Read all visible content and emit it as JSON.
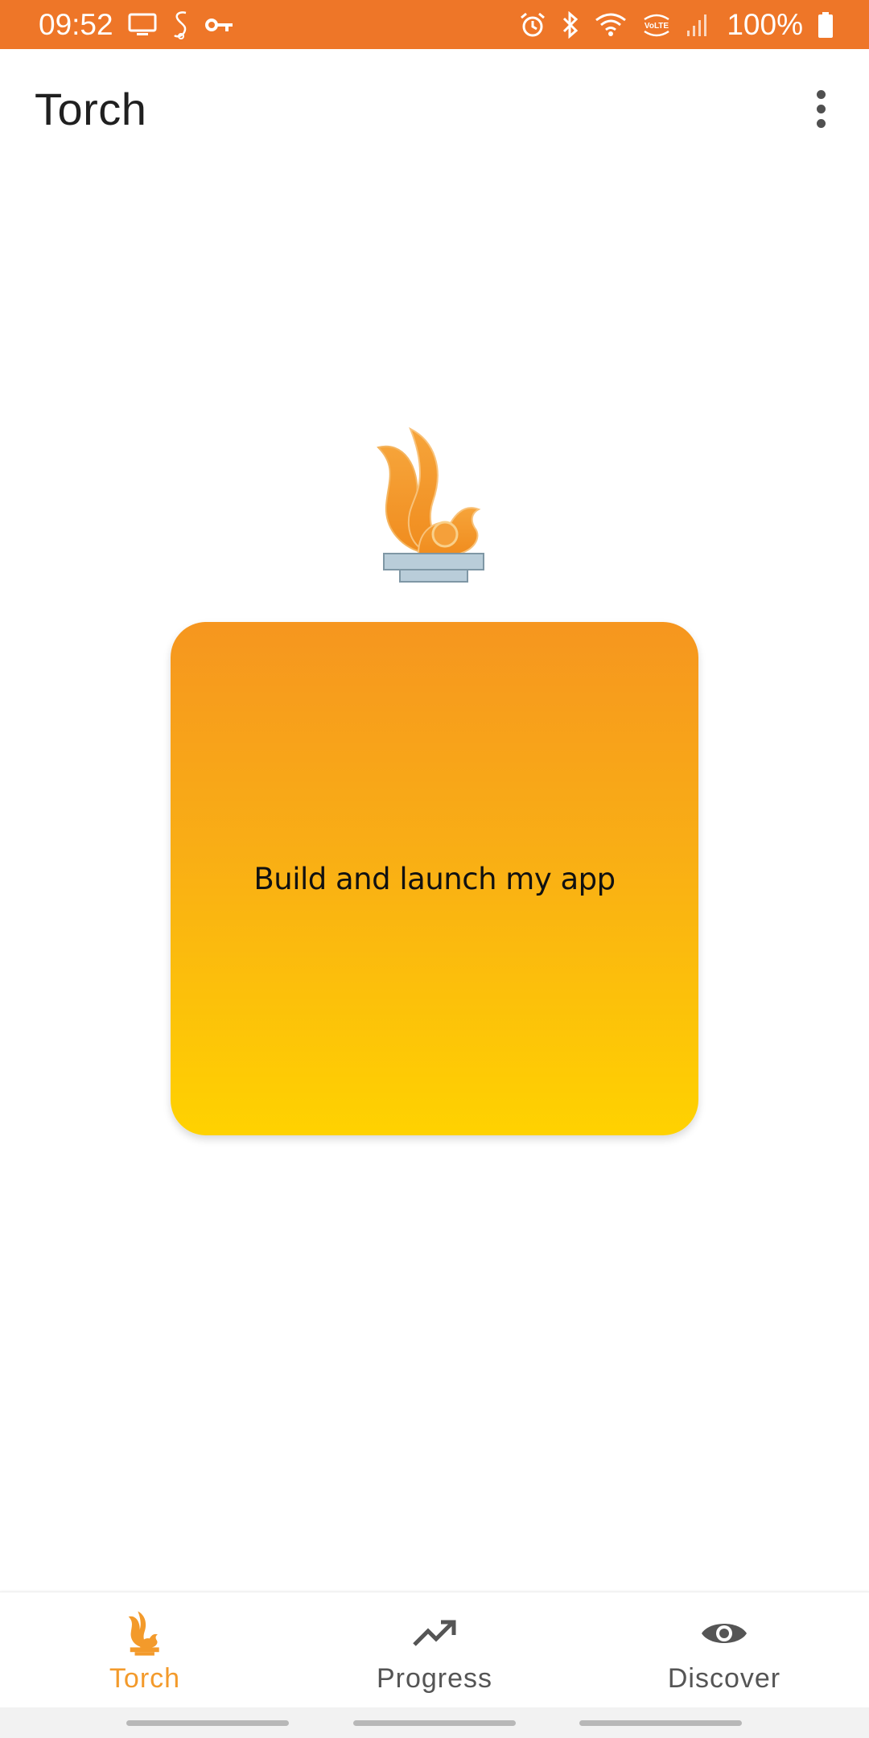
{
  "status_bar": {
    "time": "09:52",
    "battery": "100%",
    "left_icons": [
      "screen-cast-icon",
      "app-s-icon",
      "key-icon"
    ],
    "right_icons": [
      "alarm-icon",
      "bluetooth-icon",
      "wifi-icon",
      "volte-icon",
      "signal-icon",
      "battery-icon"
    ],
    "background_color": "#EE7628"
  },
  "app_bar": {
    "title": "Torch",
    "menu_icon": "more-vert-icon"
  },
  "main": {
    "logo_icon": "torch-flame-icon",
    "card_label": "Build and launch my app",
    "card_gradient": [
      "#F6961F",
      "#FFD200"
    ]
  },
  "bottom_nav": {
    "items": [
      {
        "label": "Torch",
        "icon": "torch-flame-icon",
        "active": true
      },
      {
        "label": "Progress",
        "icon": "trending-up-icon",
        "active": false
      },
      {
        "label": "Discover",
        "icon": "eye-icon",
        "active": false
      }
    ],
    "active_color": "#F39A2B",
    "inactive_color": "#555555"
  }
}
